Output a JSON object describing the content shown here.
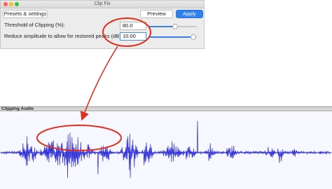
{
  "window": {
    "title": "Clip Fix"
  },
  "toolbar": {
    "presets_label": "Presets & settings",
    "preview_label": "Preview",
    "apply_label": "Apply"
  },
  "threshold": {
    "label": "Threshold of Clipping (%):",
    "value": "80.0",
    "slider_fraction": 0.55
  },
  "reduce": {
    "label": "Reduce amplitude to allow for restored peaks (dB):",
    "value": "10.00",
    "slider_fraction": 0.92
  },
  "wave": {
    "title": "Clipping Audio"
  },
  "colors": {
    "accent": "#2f80ed",
    "annotation": "#e0301e",
    "waveform": "#2b2bd6",
    "dialog_bg": "#ececec"
  }
}
